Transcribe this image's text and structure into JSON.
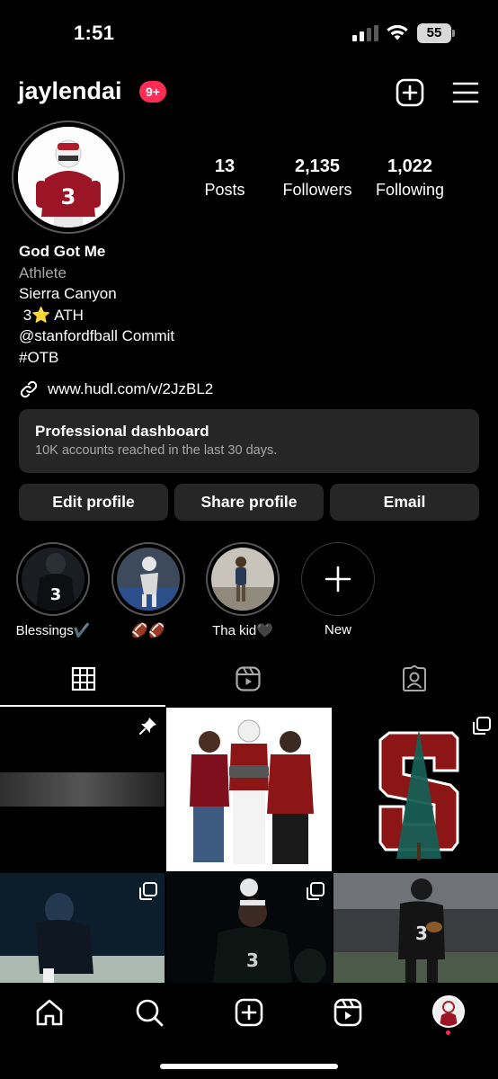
{
  "status_bar": {
    "time": "1:51",
    "battery": "55"
  },
  "header": {
    "username": "jaylendai",
    "notification_badge": "9+"
  },
  "stats": {
    "posts": {
      "value": "13",
      "label": "Posts"
    },
    "followers": {
      "value": "2,135",
      "label": "Followers"
    },
    "following": {
      "value": "1,022",
      "label": "Following"
    }
  },
  "bio": {
    "name": "God Got Me",
    "category": "Athlete",
    "lines": [
      "Sierra Canyon",
      " 3⭐️ ATH",
      "@stanfordfball Commit",
      "#OTB"
    ],
    "link": "www.hudl.com/v/2JzBL2"
  },
  "dashboard": {
    "title": "Professional dashboard",
    "subtitle": "10K accounts reached in the last 30 days."
  },
  "actions": {
    "edit": "Edit profile",
    "share": "Share profile",
    "email": "Email"
  },
  "highlights": [
    {
      "label": "Blessings✔️"
    },
    {
      "label": "🏈🏈"
    },
    {
      "label": "Tha kid🖤"
    },
    {
      "label": "New"
    }
  ],
  "tabs": [
    "grid-icon",
    "reels-icon",
    "tagged-icon"
  ],
  "grid": [
    {
      "badge": "pin-icon"
    },
    {
      "badge": "carousel-icon"
    },
    {
      "badge": "carousel-icon"
    },
    {
      "badge": "carousel-icon"
    },
    {
      "badge": "carousel-icon"
    },
    {
      "badge": "carousel-icon"
    }
  ],
  "bottom_nav": [
    "home-icon",
    "search-icon",
    "create-icon",
    "reels-icon",
    "profile-avatar"
  ],
  "colors": {
    "background": "#000000",
    "surface": "#262626",
    "badge": "#ff2d55",
    "stanford_red": "#8c1515",
    "stanford_green": "#175e54"
  }
}
